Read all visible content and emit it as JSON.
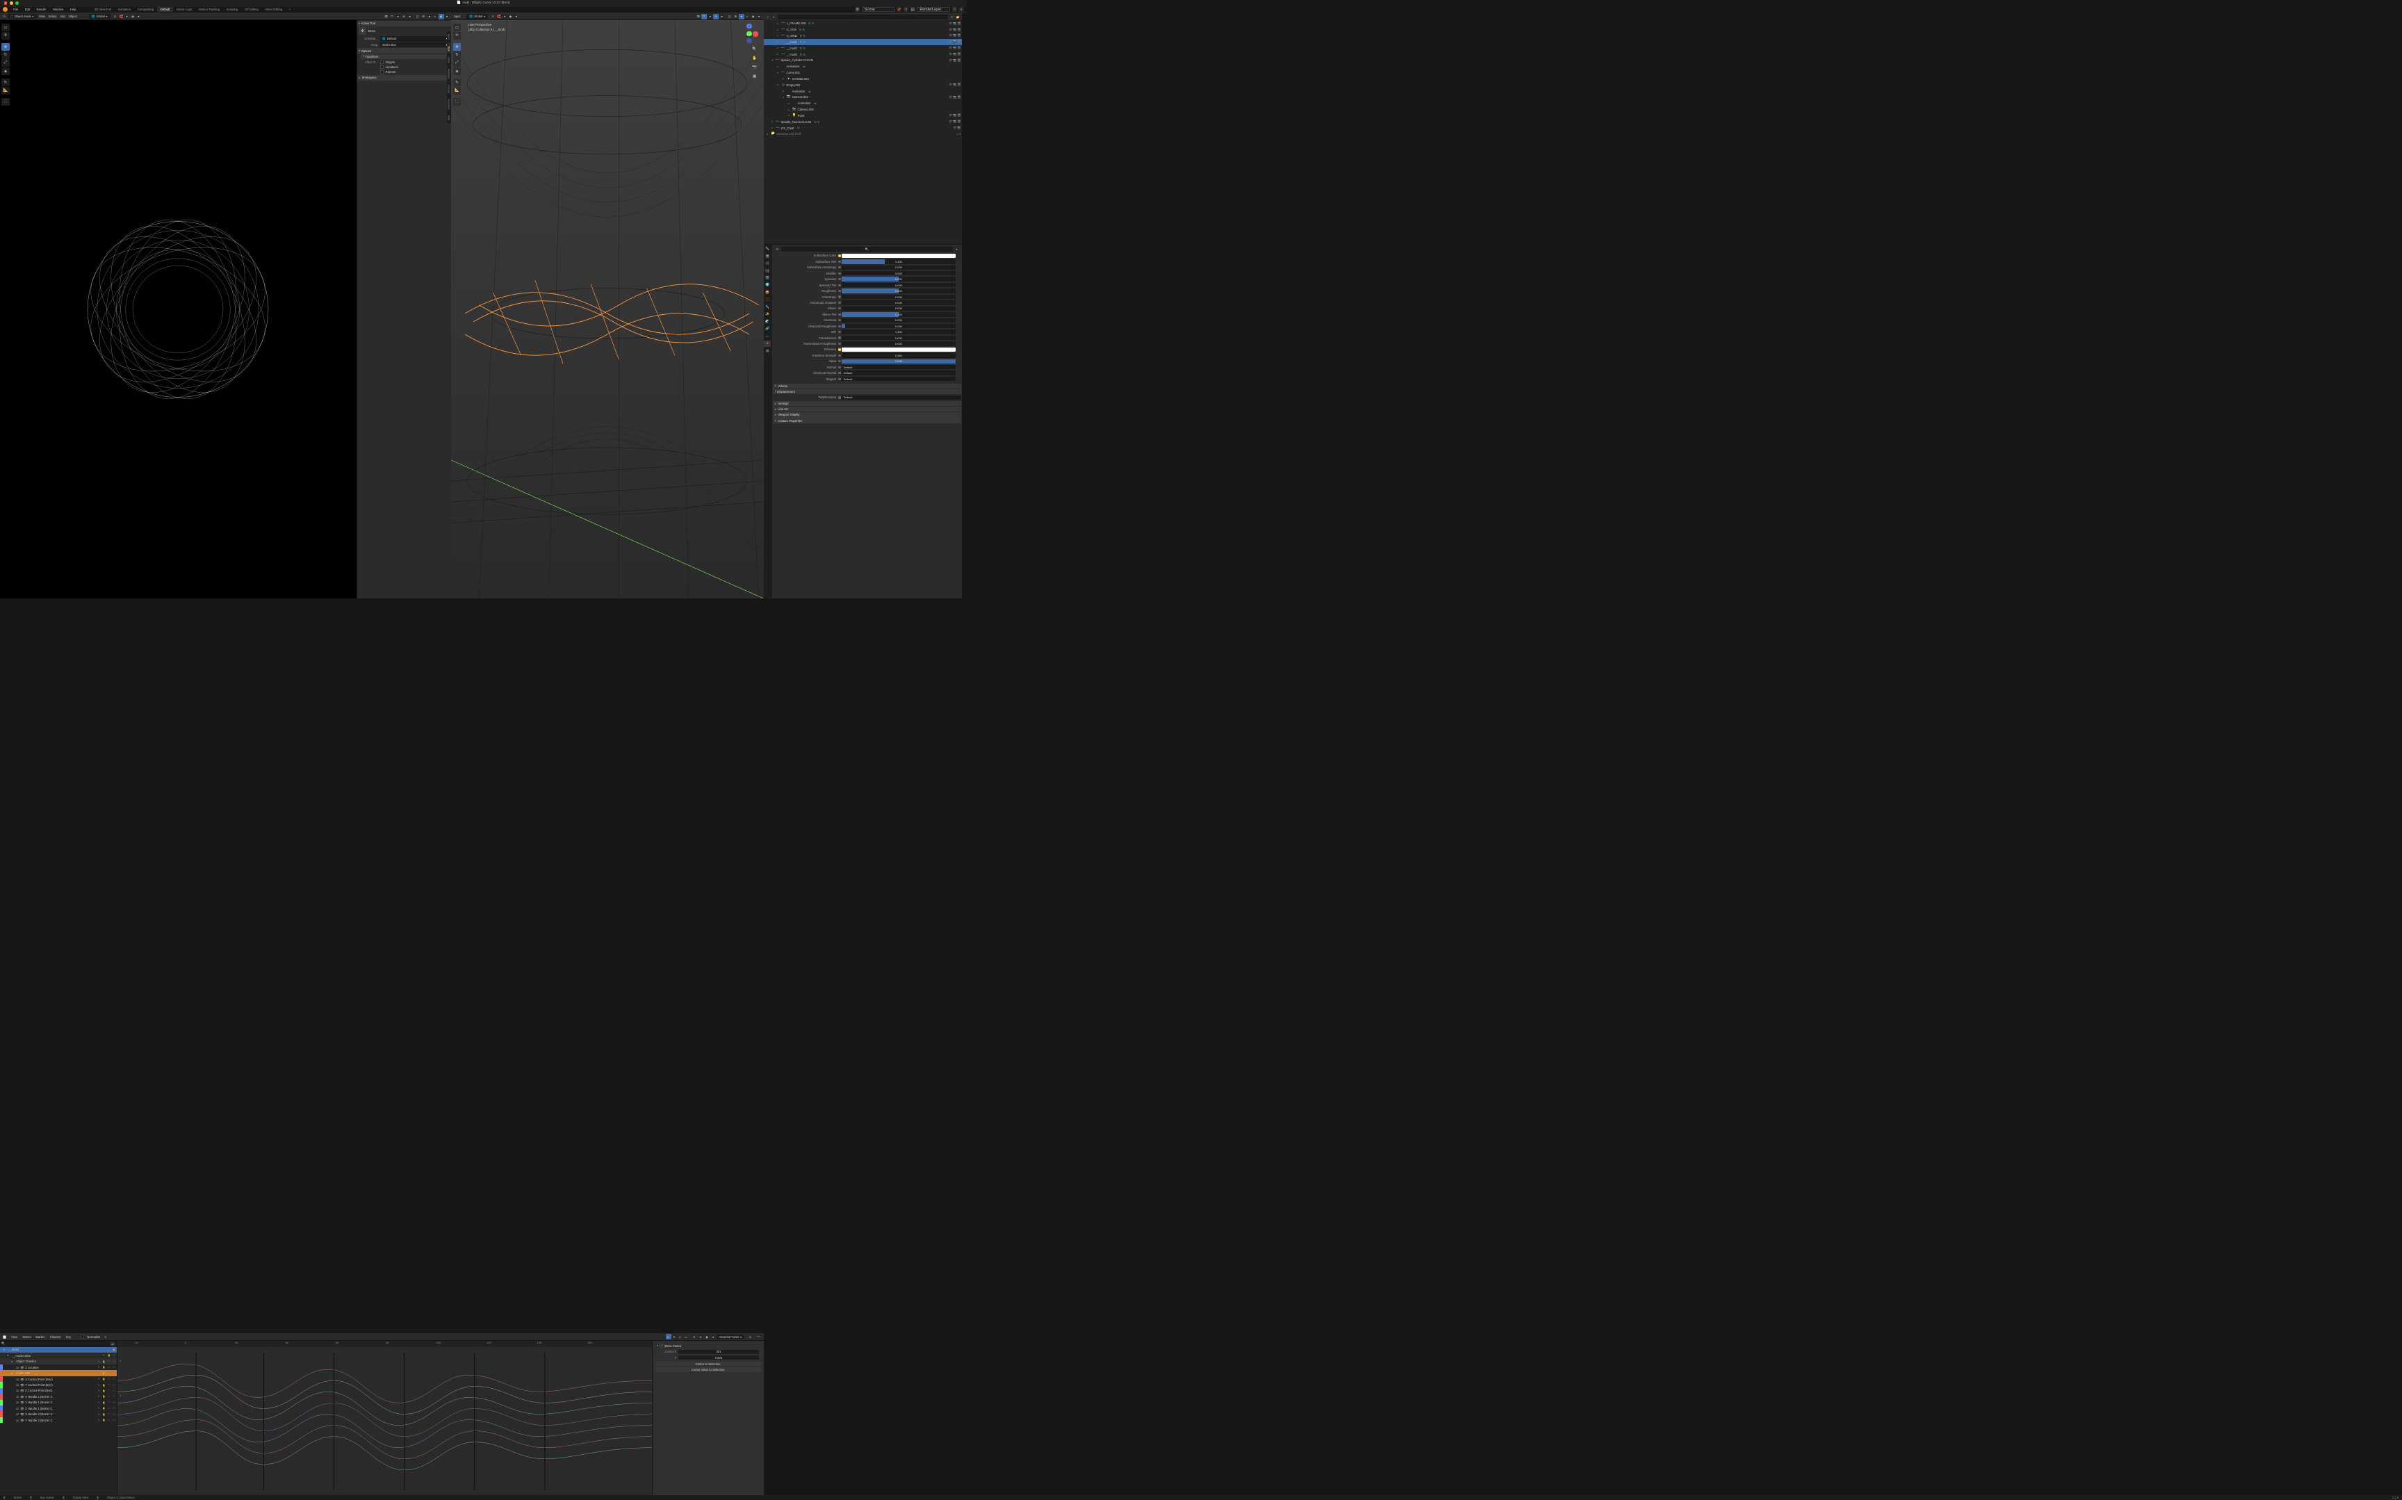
{
  "title": "AoB - Elliptic Curve v2.07.blend",
  "menus": [
    "File",
    "Edit",
    "Render",
    "Window",
    "Help"
  ],
  "workspaces": [
    "3D View Full",
    "Animation",
    "Compositing",
    "Default",
    "Game Logic",
    "Motion Tracking",
    "Scripting",
    "UV Editing",
    "Video Editing"
  ],
  "active_workspace": "Default",
  "scene": "Scene",
  "view_layer": "RenderLayer",
  "vp_left": {
    "mode": "Object Mode",
    "menus": [
      "View",
      "Select",
      "Add",
      "Object"
    ],
    "orient": "Global",
    "active_tool": "Move",
    "panel": {
      "active_tool_header": "Active Tool",
      "tool_name": "Move",
      "orient_label": "Orientati…",
      "orient_val": "Default",
      "drag_label": "Drag:",
      "drag_val": "Select Box",
      "options_header": "Options",
      "transform_header": "Transform",
      "affect_label": "Affect O…",
      "affect": [
        "Origins",
        "Locations",
        "Parents"
      ],
      "workspace_header": "Workspace"
    },
    "ntabs": [
      "Item",
      "Tool",
      "View",
      "Animate",
      "Create",
      "TreeGen",
      "Edit"
    ]
  },
  "vp_mid": {
    "mode_trail": "bject",
    "orient": "Global",
    "overlay": {
      "line1": "User Perspective",
      "line2": "(351) Collection 4 | __mod1"
    }
  },
  "ge": {
    "menus": [
      "View",
      "Select",
      "Marker",
      "Channel",
      "Key"
    ],
    "normalize": "Normalize",
    "nearest": "Nearest Frame",
    "ticks": [
      -20,
      0,
      20,
      40,
      60,
      80,
      100,
      120,
      140,
      160
    ],
    "ylabels": [
      "5",
      "0"
    ],
    "channels": [
      {
        "lvl": "lvl1",
        "label": "__mod1",
        "toggles": "pl"
      },
      {
        "lvl": "lvl2",
        "label": "__mod1Action",
        "toggles": "plc"
      },
      {
        "lvl": "lvl3",
        "label": "Object Transfor",
        "toggles": "plmc"
      },
      {
        "lvl": "leaf",
        "label": "Z Location",
        "color": "#5b7fff",
        "toggles": "plmc"
      },
      {
        "lvl": "lvl3",
        "sel": true,
        "label": "Curve.190",
        "toggles": "plmc"
      },
      {
        "lvl": "leaf",
        "label": "X Control Point (Bez)",
        "color": "#ff4d4d",
        "toggles": "plmc"
      },
      {
        "lvl": "leaf",
        "label": "Y Control Point (Bez)",
        "color": "#5bff5b",
        "toggles": "plmc"
      },
      {
        "lvl": "leaf",
        "label": "Z Control Point (Bez)",
        "color": "#5b7fff",
        "toggles": "plmc"
      },
      {
        "lvl": "leaf",
        "label": "X Handle 1 (Bezier C",
        "color": "#ff4d4d",
        "toggles": "plmc"
      },
      {
        "lvl": "leaf",
        "label": "Y Handle 1 (Bezier C",
        "color": "#5bff5b",
        "toggles": "plmc"
      },
      {
        "lvl": "leaf",
        "label": "Z Handle 1 (Bezier C",
        "color": "#5b7fff",
        "toggles": "plmc"
      },
      {
        "lvl": "leaf",
        "label": "X Handle 2 (Bezier C",
        "color": "#ff4d4d",
        "toggles": "plmc"
      },
      {
        "lvl": "leaf",
        "label": "Y Handle 2 (Bezier C",
        "color": "#5bff5b",
        "toggles": "plmc"
      }
    ],
    "side": {
      "show_cursor": "Show Cursor",
      "cursor_x_label": "Cursor X",
      "cursor_x": "351",
      "cursor_y_label": "Y",
      "cursor_y": "0.000",
      "btn1": "Cursor to Selection",
      "btn2": "Cursor Value to Selection"
    }
  },
  "outliner": [
    {
      "d": 1,
      "icon": "curve",
      "label": "1_FRAME.006",
      "tg": "ecr",
      "link": true
    },
    {
      "d": 1,
      "icon": "curve",
      "label": "3_AXIS",
      "tg": "ecr",
      "link": true
    },
    {
      "d": 1,
      "icon": "curve",
      "label": "3_GRID",
      "tg": "ecr",
      "link": true
    },
    {
      "d": 1,
      "sel": true,
      "icon": "curve-sel",
      "label": "__mod1",
      "tg": "ecr",
      "link": true
    },
    {
      "d": 1,
      "icon": "curve",
      "label": "__mod2",
      "tg": "ecr",
      "link": true
    },
    {
      "d": 1,
      "icon": "curve",
      "label": "__mod3",
      "tg": "ecr",
      "link": true
    },
    {
      "d": 0,
      "icon": "curve",
      "label": "SpiralA_Cylinder.CLEAN",
      "tg": "ecr",
      "exp": true
    },
    {
      "d": 1,
      "icon": "",
      "label": "Animation",
      "sub": "anim"
    },
    {
      "d": 1,
      "icon": "curveg",
      "label": "Curve.031",
      "exp": true
    },
    {
      "d": 2,
      "icon": "mat",
      "label": "SVGMat.003"
    },
    {
      "d": 1,
      "icon": "empty",
      "label": "Empty.002",
      "tg": "ecr",
      "exp": true
    },
    {
      "d": 2,
      "icon": "",
      "label": "Animation",
      "sub": "anim"
    },
    {
      "d": 2,
      "icon": "cam",
      "label": "Camera.002",
      "tg": "ecr",
      "exp": true
    },
    {
      "d": 3,
      "icon": "",
      "label": "Animation",
      "sub": "anim"
    },
    {
      "d": 3,
      "icon": "camg",
      "label": "Camera.002"
    },
    {
      "d": 3,
      "icon": "light",
      "label": "Point",
      "tg": "ecr"
    },
    {
      "d": 0,
      "icon": "curve",
      "label": "SpiralB_Taurus.CLEAN",
      "tg": "ecr",
      "link": true
    },
    {
      "d": 0,
      "icon": "curve",
      "label": "zzz_Chart",
      "sub": "10",
      "tg": "ec"
    },
    {
      "d": -1,
      "icon": "coll",
      "label": "Cameras and Stuff",
      "tg": "bx"
    }
  ],
  "props": {
    "items": [
      {
        "label": "Subsurface Color",
        "type": "color",
        "val": "#ffffff",
        "anim": true
      },
      {
        "label": "Subsurface IOR",
        "type": "slider",
        "val": "1.400",
        "fill": 38
      },
      {
        "label": "Subsurface Anisotropy",
        "type": "slider",
        "val": "0.000",
        "fill": 0
      },
      {
        "label": "Metallic",
        "type": "slider",
        "val": "0.000",
        "fill": 0
      },
      {
        "label": "Specular",
        "type": "slider",
        "val": "0.500",
        "fill": 50
      },
      {
        "label": "Specular Tint",
        "type": "slider",
        "val": "0.000",
        "fill": 0
      },
      {
        "label": "Roughness",
        "type": "slider",
        "val": "0.500",
        "fill": 50
      },
      {
        "label": "Anisotropic",
        "type": "slider",
        "val": "0.000",
        "fill": 0
      },
      {
        "label": "Anisotropic Rotation",
        "type": "slider",
        "val": "0.000",
        "fill": 0
      },
      {
        "label": "Sheen",
        "type": "slider",
        "val": "0.000",
        "fill": 0
      },
      {
        "label": "Sheen Tint",
        "type": "slider",
        "val": "0.500",
        "fill": 50
      },
      {
        "label": "Clearcoat",
        "type": "slider",
        "val": "0.000",
        "fill": 0
      },
      {
        "label": "Clearcoat Roughness",
        "type": "slider",
        "val": "0.030",
        "fill": 3
      },
      {
        "label": "IOR",
        "type": "slider",
        "val": "1.450",
        "fill": 0
      },
      {
        "label": "Transmission",
        "type": "slider",
        "val": "0.000",
        "fill": 0
      },
      {
        "label": "Transmission Roughness",
        "type": "slider",
        "val": "0.000",
        "fill": 0
      },
      {
        "label": "Emission",
        "type": "color",
        "val": "#ffffff",
        "anim": true
      },
      {
        "label": "Emission Strength",
        "type": "slider",
        "val": "0.440",
        "fill": 0
      },
      {
        "label": "Alpha",
        "type": "slider",
        "val": "1.000",
        "fill": 100
      },
      {
        "label": "Normal",
        "type": "drop",
        "val": "Default"
      },
      {
        "label": "Clearcoat Normal",
        "type": "drop",
        "val": "Default"
      },
      {
        "label": "Tangent",
        "type": "drop",
        "val": "Default"
      }
    ],
    "sections": [
      "Volume",
      "Displacement"
    ],
    "disp_label": "Displacement",
    "disp_val": "Default",
    "bottom_sections": [
      "Settings",
      "Line Art",
      "Viewport Display",
      "Custom Properties"
    ]
  },
  "version": "3.1.0",
  "status": {
    "select": "Select",
    "box": "Box Select",
    "rotate": "Rotate View",
    "context": "Object Context Menu"
  }
}
